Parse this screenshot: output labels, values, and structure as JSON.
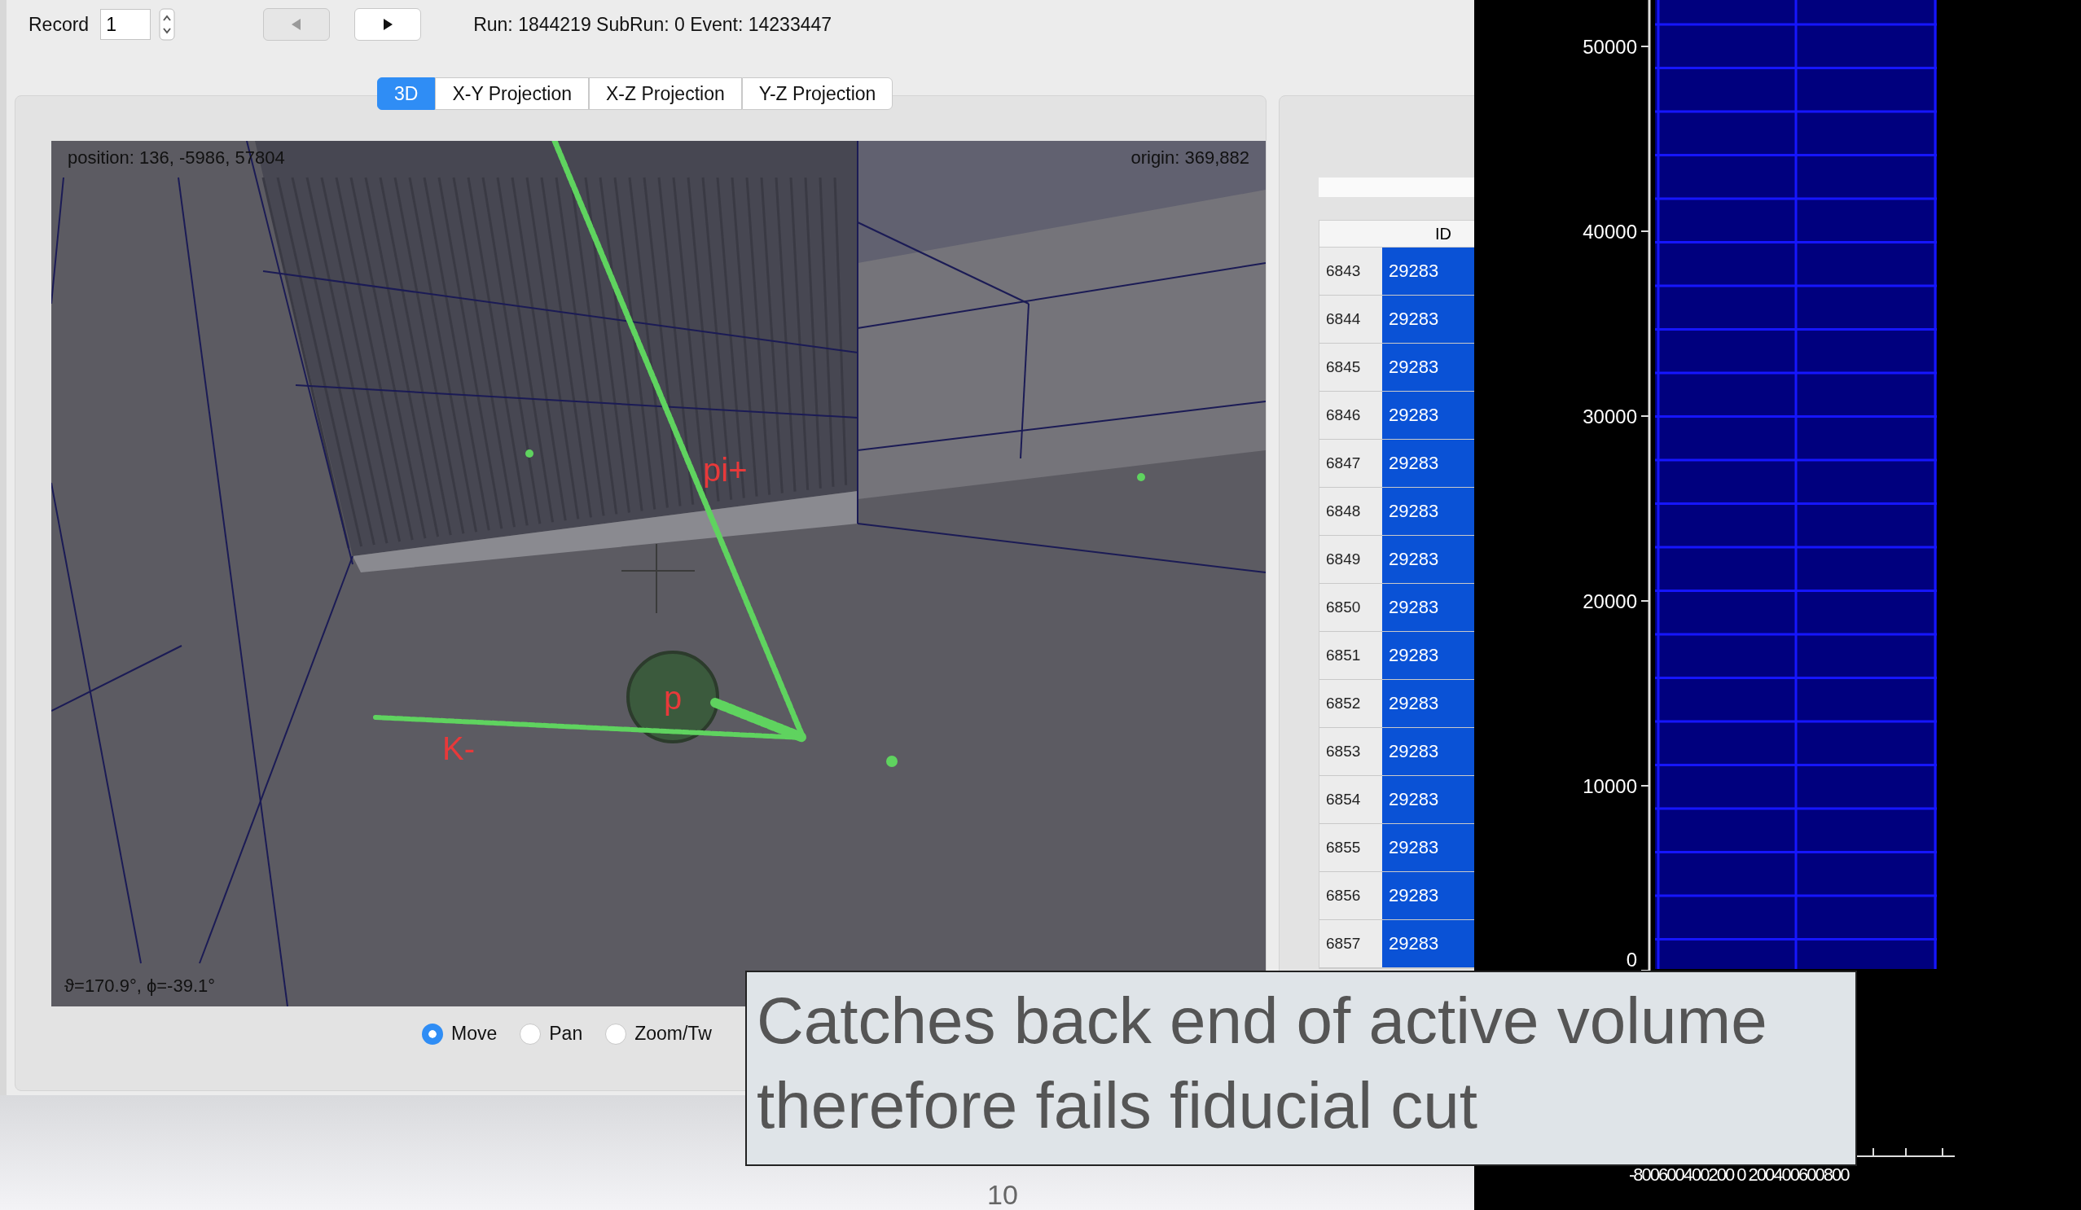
{
  "toolbar": {
    "record_label": "Record",
    "record_value": "1",
    "prev_disabled": true,
    "run_info": "Run: 1844219  SubRun: 0  Event: 14233447"
  },
  "tabs": [
    {
      "label": "3D",
      "selected": true
    },
    {
      "label": "X-Y Projection",
      "selected": false
    },
    {
      "label": "X-Z Projection",
      "selected": false
    },
    {
      "label": "Y-Z Projection",
      "selected": false
    }
  ],
  "viewer": {
    "position": "position: 136, -5986, 57804",
    "origin": "origin: 369,882",
    "angles": "ϑ=170.9°, ϕ=-39.1°",
    "tracks": [
      {
        "label": "pi+"
      },
      {
        "label": "p"
      },
      {
        "label": "K-"
      }
    ]
  },
  "modes": [
    {
      "label": "Move",
      "selected": true
    },
    {
      "label": "Pan",
      "selected": false
    },
    {
      "label": "Zoom/Tw",
      "selected": false
    }
  ],
  "table": {
    "columns": [
      "ID"
    ],
    "rows": [
      {
        "number": "6843",
        "id": "29283"
      },
      {
        "number": "6844",
        "id": "29283"
      },
      {
        "number": "6845",
        "id": "29283"
      },
      {
        "number": "6846",
        "id": "29283"
      },
      {
        "number": "6847",
        "id": "29283"
      },
      {
        "number": "6848",
        "id": "29283"
      },
      {
        "number": "6849",
        "id": "29283"
      },
      {
        "number": "6850",
        "id": "29283"
      },
      {
        "number": "6851",
        "id": "29283"
      },
      {
        "number": "6852",
        "id": "29283"
      },
      {
        "number": "6853",
        "id": "29283"
      },
      {
        "number": "6854",
        "id": "29283"
      },
      {
        "number": "6855",
        "id": "29283"
      },
      {
        "number": "6856",
        "id": "29283"
      },
      {
        "number": "6857",
        "id": "29283"
      }
    ]
  },
  "histogram": {
    "y_ticks": [
      "50000",
      "40000",
      "30000",
      "20000",
      "10000",
      "0"
    ],
    "x_tick_labels": "-800600400200 0 200400600800"
  },
  "caption": "Catches back end of active volume therefore fails fiducial cut",
  "page_number": "10"
}
